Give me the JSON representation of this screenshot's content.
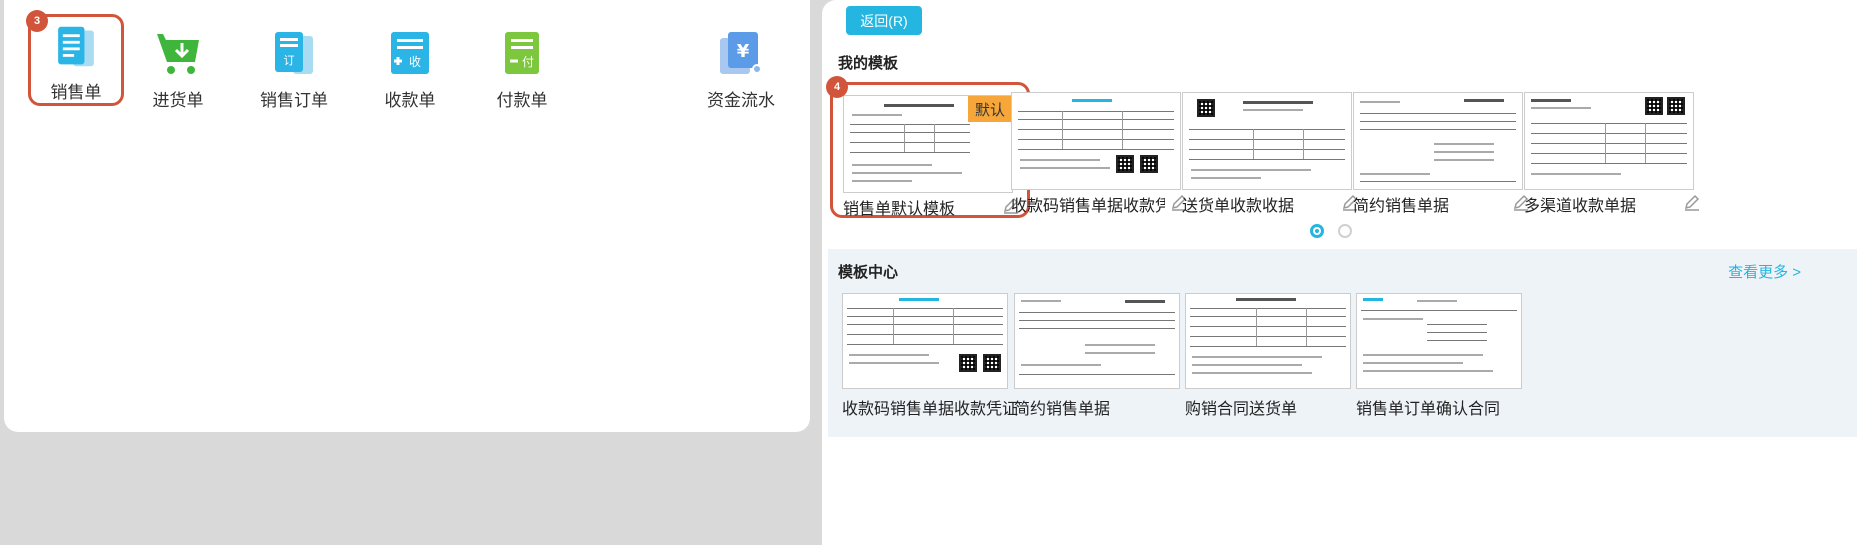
{
  "doc_types": [
    {
      "label": "销售单",
      "icon": "sales-doc-icon",
      "color": "#2bb5e6"
    },
    {
      "label": "进货单",
      "icon": "shopping-cart-icon",
      "color": "#3fb63b"
    },
    {
      "label": "销售订单",
      "icon": "sales-order-icon",
      "color": "#2bb5e6"
    },
    {
      "label": "收款单",
      "icon": "receipt-icon",
      "color": "#2bb5e6"
    },
    {
      "label": "付款单",
      "icon": "payment-icon",
      "color": "#7dc73f"
    },
    {
      "label": "资金流水",
      "icon": "cash-flow-icon",
      "color": "#5b9be8"
    }
  ],
  "doc_icon_glyphs": {
    "order": "订",
    "receipt": "收",
    "payment": "付",
    "cash": "¥"
  },
  "steps": {
    "doc_type": "3",
    "template": "4"
  },
  "right": {
    "back_label": "返回(R)",
    "my_templates_title": "我的模板",
    "default_tag": "默认",
    "center_title": "模板中心",
    "more_link": "查看更多 >"
  },
  "my_templates": [
    {
      "name": "销售单默认模板"
    },
    {
      "name": "收款码销售单据收款凭证"
    },
    {
      "name": "送货单收款收据"
    },
    {
      "name": "简约销售单据"
    },
    {
      "name": "多渠道收款单据"
    }
  ],
  "center_templates": [
    {
      "name": "收款码销售单据收款凭证"
    },
    {
      "name": "简约销售单据"
    },
    {
      "name": "购销合同送货单"
    },
    {
      "name": "销售单订单确认合同"
    }
  ],
  "pagination": {
    "pages": 2,
    "current": 1
  },
  "colors": {
    "accent": "#24b5e0",
    "highlight": "#d2553b",
    "default_tag": "#f7a73a"
  }
}
